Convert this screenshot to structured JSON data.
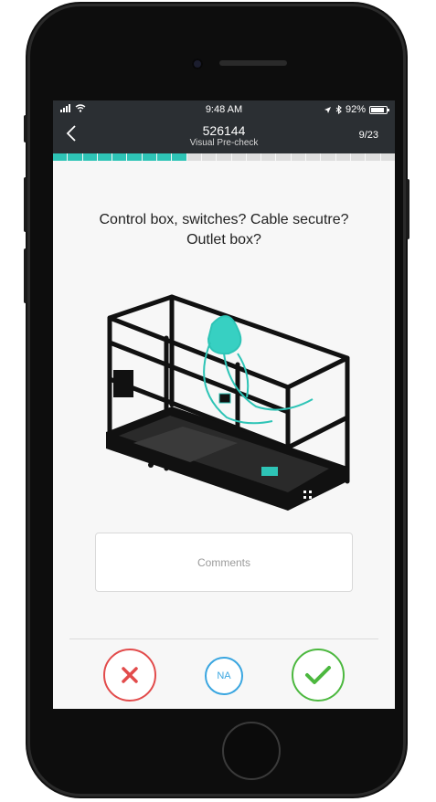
{
  "status": {
    "time": "9:48 AM",
    "battery": "92%"
  },
  "header": {
    "title": "526144",
    "subtitle": "Visual Pre-check",
    "counter": "9/23",
    "back_icon": "chevron-left-icon"
  },
  "progress": {
    "current": 9,
    "total": 23,
    "color": "#2ec4b6"
  },
  "question": {
    "text": "Control box, switches? Cable secutre? Outlet box?"
  },
  "comments": {
    "placeholder": "Comments"
  },
  "actions": {
    "fail_icon": "x-icon",
    "fail_color": "#e24b4b",
    "na_label": "NA",
    "na_color": "#3aa6e0",
    "pass_icon": "check-icon",
    "pass_color": "#4cb83f"
  }
}
